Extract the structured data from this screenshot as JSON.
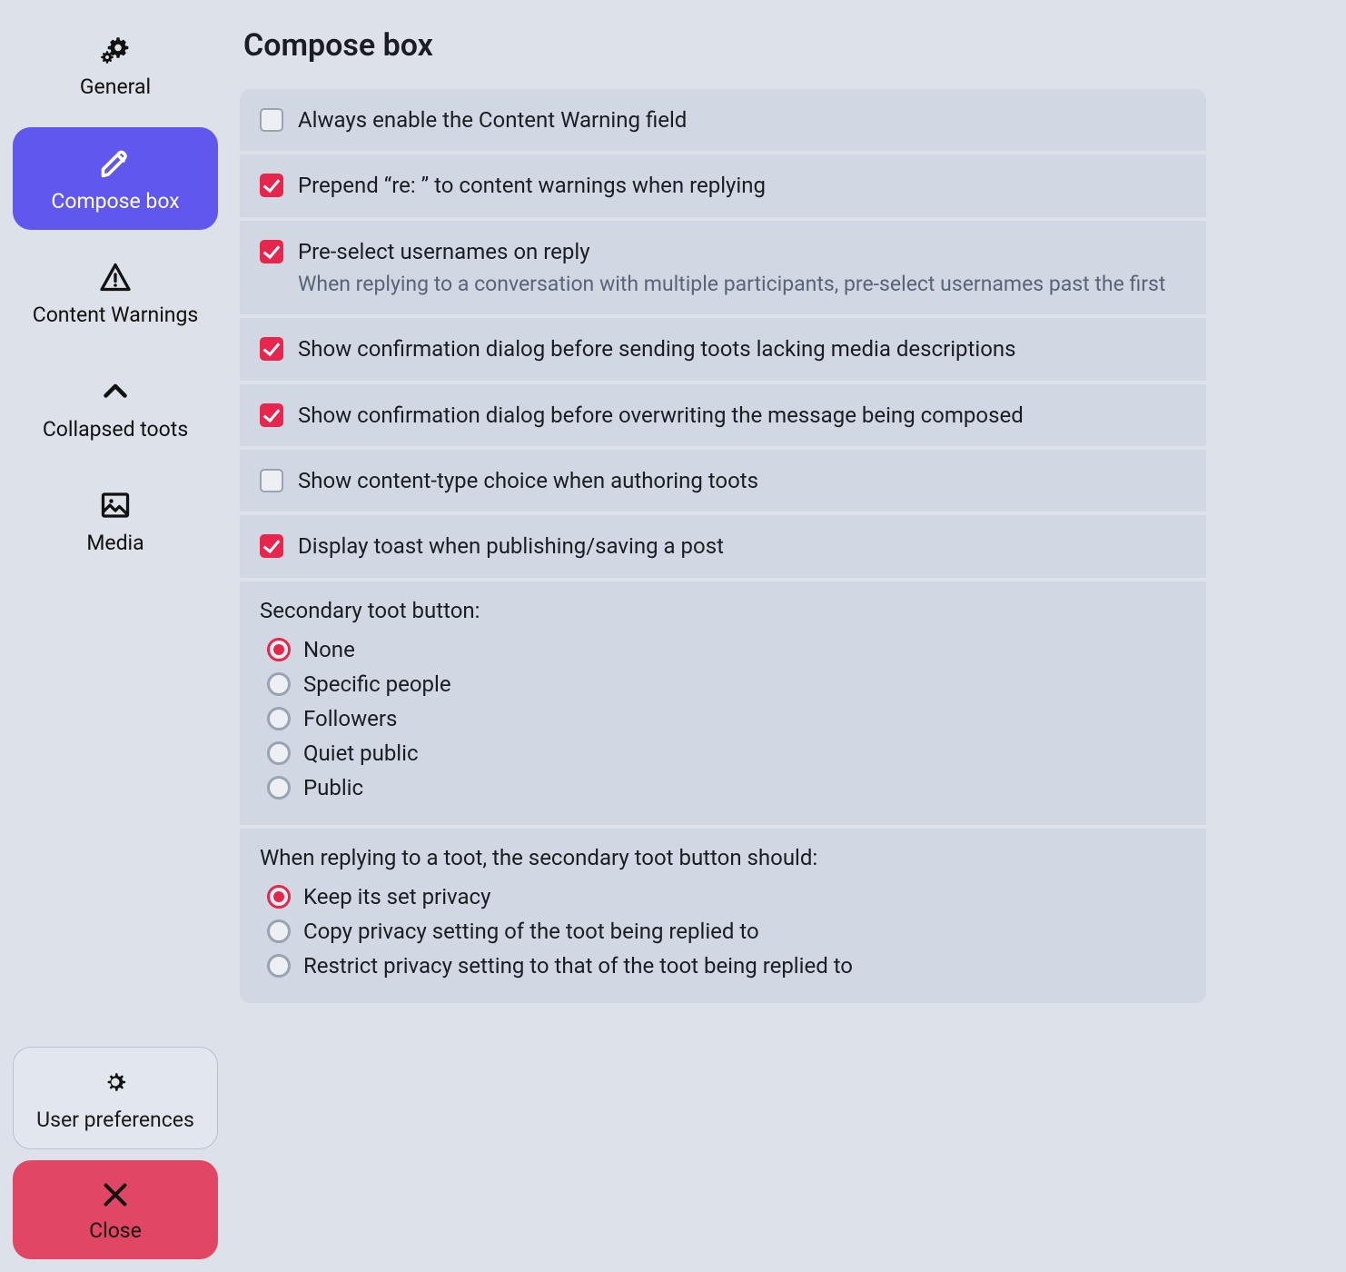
{
  "page": {
    "title": "Compose box"
  },
  "sidebar": {
    "items": [
      {
        "key": "general",
        "label": "General"
      },
      {
        "key": "compose",
        "label": "Compose box"
      },
      {
        "key": "cw",
        "label": "Content Warnings"
      },
      {
        "key": "collapsed",
        "label": "Collapsed toots"
      },
      {
        "key": "media",
        "label": "Media"
      }
    ],
    "preferences_label": "User preferences",
    "close_label": "Close",
    "active_key": "compose"
  },
  "options": {
    "always_cw": {
      "label": "Always enable the Content Warning field",
      "checked": false
    },
    "prepend_re": {
      "label": "Prepend “re: ” to content warnings when replying",
      "checked": true
    },
    "preselect_users": {
      "label": "Pre-select usernames on reply",
      "desc": "When replying to a conversation with multiple participants, pre-select usernames past the first",
      "checked": true
    },
    "confirm_no_media": {
      "label": "Show confirmation dialog before sending toots lacking media descriptions",
      "checked": true
    },
    "confirm_overwrite": {
      "label": "Show confirmation dialog before overwriting the message being composed",
      "checked": true
    },
    "content_type": {
      "label": "Show content-type choice when authoring toots",
      "checked": false
    },
    "display_toast": {
      "label": "Display toast when publishing/saving a post",
      "checked": true
    }
  },
  "secondary_button": {
    "title": "Secondary toot button:",
    "selected": "none",
    "options": [
      {
        "key": "none",
        "label": "None"
      },
      {
        "key": "specific",
        "label": "Specific people"
      },
      {
        "key": "followers",
        "label": "Followers"
      },
      {
        "key": "quiet",
        "label": "Quiet public"
      },
      {
        "key": "public",
        "label": "Public"
      }
    ]
  },
  "reply_privacy": {
    "title": "When replying to a toot, the secondary toot button should:",
    "selected": "keep",
    "options": [
      {
        "key": "keep",
        "label": "Keep its set privacy"
      },
      {
        "key": "copy",
        "label": "Copy privacy setting of the toot being replied to"
      },
      {
        "key": "restrict",
        "label": "Restrict privacy setting to that of the toot being replied to"
      }
    ]
  }
}
